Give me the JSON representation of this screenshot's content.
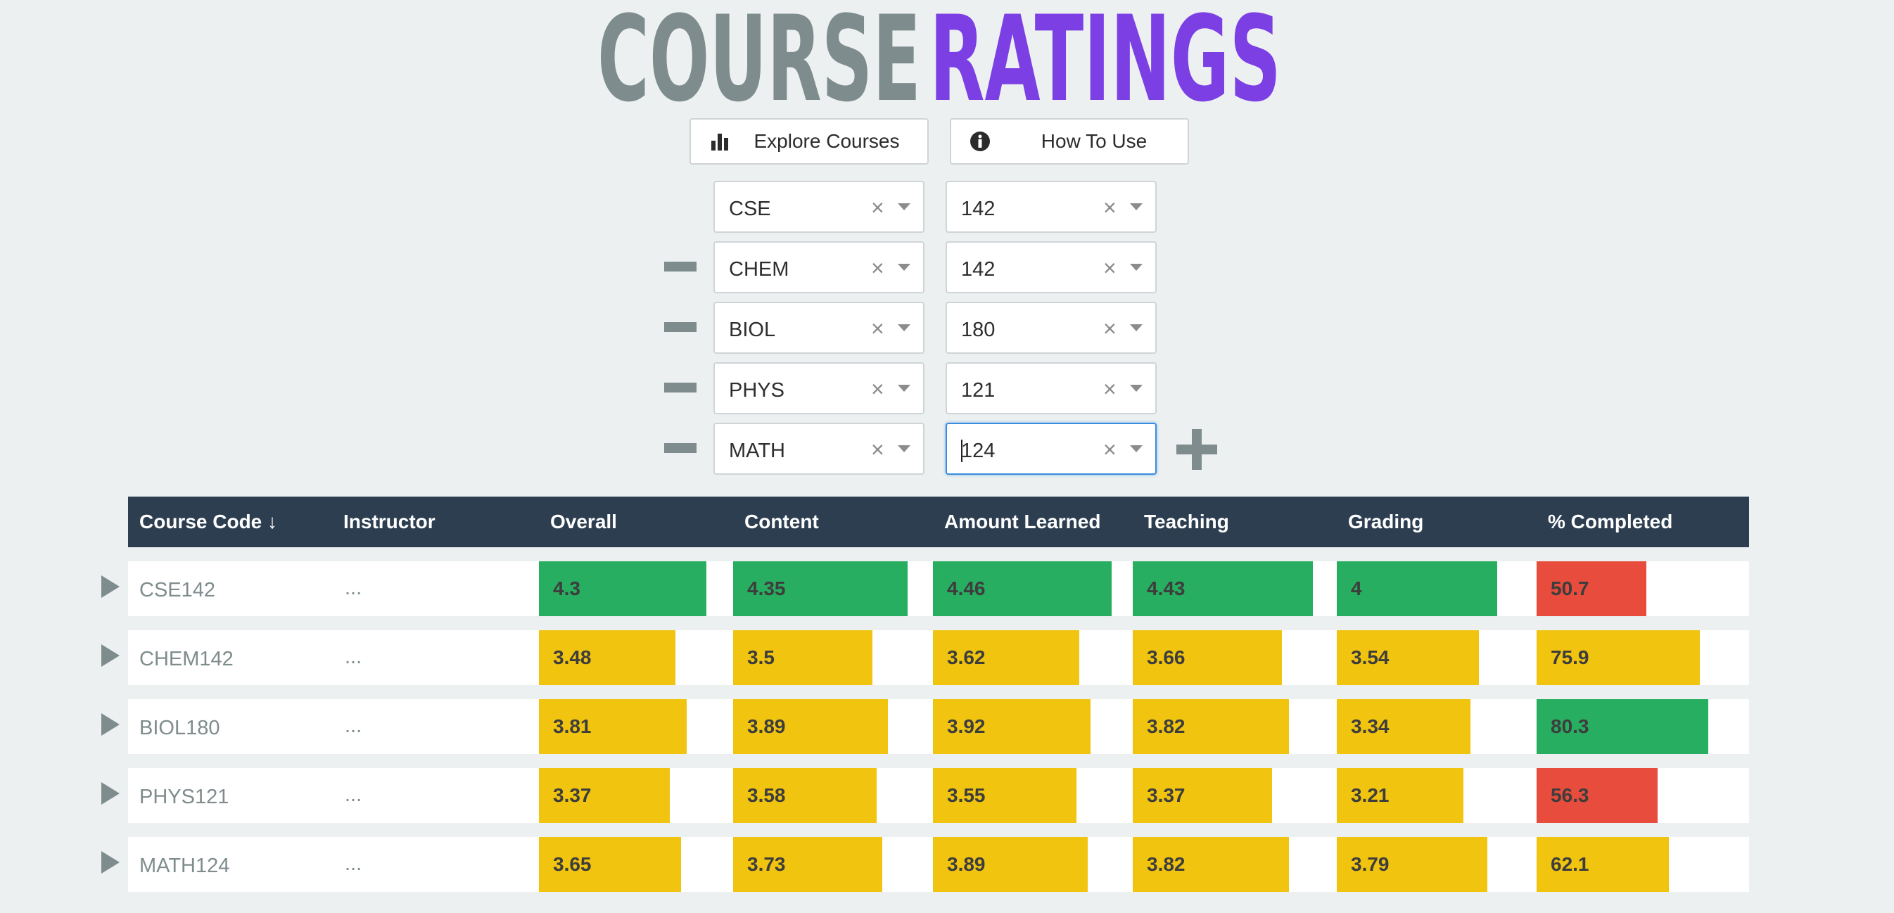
{
  "logo": {
    "part1": "COURSE",
    "part2": "RATINGS"
  },
  "nav": {
    "explore_label": "Explore Courses",
    "howto_label": "How To Use"
  },
  "selectors": [
    {
      "dept": "CSE",
      "num": "142"
    },
    {
      "dept": "CHEM",
      "num": "142"
    },
    {
      "dept": "BIOL",
      "num": "180"
    },
    {
      "dept": "PHYS",
      "num": "121"
    },
    {
      "dept": "MATH",
      "num": "124"
    }
  ],
  "clear_glyph": "×",
  "table": {
    "headers": {
      "code": "Course Code ↓",
      "instructor": "Instructor",
      "overall": "Overall",
      "content": "Content",
      "learned": "Amount Learned",
      "teaching": "Teaching",
      "grading": "Grading",
      "completed": "% Completed"
    },
    "rows": [
      {
        "code": "CSE142",
        "instructor": "...",
        "overall": "4.3",
        "content": "4.35",
        "learned": "4.46",
        "teaching": "4.43",
        "grading": "4",
        "completed": "50.7"
      },
      {
        "code": "CHEM142",
        "instructor": "...",
        "overall": "3.48",
        "content": "3.5",
        "learned": "3.62",
        "teaching": "3.66",
        "grading": "3.54",
        "completed": "75.9"
      },
      {
        "code": "BIOL180",
        "instructor": "...",
        "overall": "3.81",
        "content": "3.89",
        "learned": "3.92",
        "teaching": "3.82",
        "grading": "3.34",
        "completed": "80.3"
      },
      {
        "code": "PHYS121",
        "instructor": "...",
        "overall": "3.37",
        "content": "3.58",
        "learned": "3.55",
        "teaching": "3.37",
        "grading": "3.21",
        "completed": "56.3"
      },
      {
        "code": "MATH124",
        "instructor": "...",
        "overall": "3.65",
        "content": "3.73",
        "learned": "3.89",
        "teaching": "3.82",
        "grading": "3.79",
        "completed": "62.1"
      }
    ]
  },
  "colors": {
    "logo_gray": "#7f8c8d",
    "logo_purple": "#7b3fe4",
    "good": "#27ae60",
    "average": "#f1c40f",
    "poor": "#e74c3c",
    "header_bg": "#2c3e50"
  }
}
